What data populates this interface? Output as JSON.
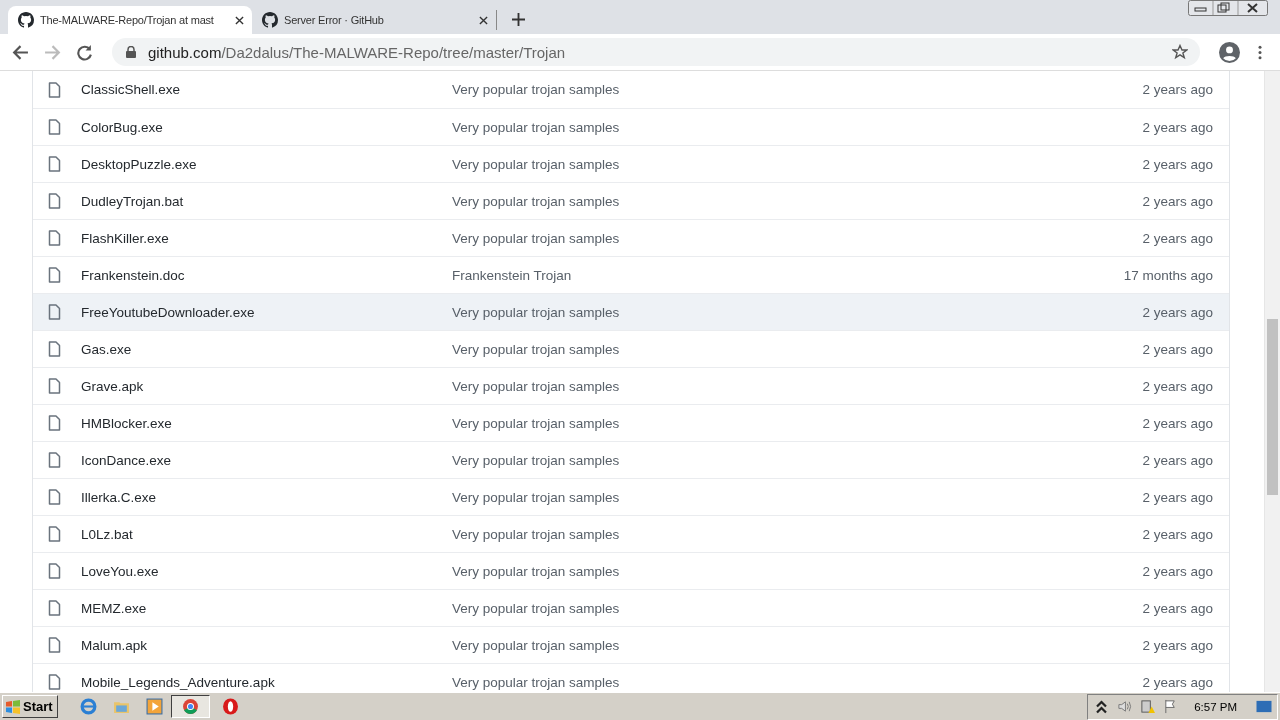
{
  "tabs": [
    {
      "title": "The-MALWARE-Repo/Trojan at mast",
      "selected": true
    },
    {
      "title": "Server Error · GitHub",
      "selected": false
    }
  ],
  "address": {
    "host": "github.com",
    "path": "/Da2dalus/The-MALWARE-Repo/tree/master/Trojan"
  },
  "files": [
    {
      "name": "ClassicShell.exe",
      "message": "Very popular trojan samples",
      "age": "2 years ago",
      "highlighted": false
    },
    {
      "name": "ColorBug.exe",
      "message": "Very popular trojan samples",
      "age": "2 years ago",
      "highlighted": false
    },
    {
      "name": "DesktopPuzzle.exe",
      "message": "Very popular trojan samples",
      "age": "2 years ago",
      "highlighted": false
    },
    {
      "name": "DudleyTrojan.bat",
      "message": "Very popular trojan samples",
      "age": "2 years ago",
      "highlighted": false
    },
    {
      "name": "FlashKiller.exe",
      "message": "Very popular trojan samples",
      "age": "2 years ago",
      "highlighted": false
    },
    {
      "name": "Frankenstein.doc",
      "message": "Frankenstein Trojan",
      "age": "17 months ago",
      "highlighted": false
    },
    {
      "name": "FreeYoutubeDownloader.exe",
      "message": "Very popular trojan samples",
      "age": "2 years ago",
      "highlighted": true
    },
    {
      "name": "Gas.exe",
      "message": "Very popular trojan samples",
      "age": "2 years ago",
      "highlighted": false
    },
    {
      "name": "Grave.apk",
      "message": "Very popular trojan samples",
      "age": "2 years ago",
      "highlighted": false
    },
    {
      "name": "HMBlocker.exe",
      "message": "Very popular trojan samples",
      "age": "2 years ago",
      "highlighted": false
    },
    {
      "name": "IconDance.exe",
      "message": "Very popular trojan samples",
      "age": "2 years ago",
      "highlighted": false
    },
    {
      "name": "Illerka.C.exe",
      "message": "Very popular trojan samples",
      "age": "2 years ago",
      "highlighted": false
    },
    {
      "name": "L0Lz.bat",
      "message": "Very popular trojan samples",
      "age": "2 years ago",
      "highlighted": false
    },
    {
      "name": "LoveYou.exe",
      "message": "Very popular trojan samples",
      "age": "2 years ago",
      "highlighted": false
    },
    {
      "name": "MEMZ.exe",
      "message": "Very popular trojan samples",
      "age": "2 years ago",
      "highlighted": false
    },
    {
      "name": "Malum.apk",
      "message": "Very popular trojan samples",
      "age": "2 years ago",
      "highlighted": false
    },
    {
      "name": "Mobile_Legends_Adventure.apk",
      "message": "Very popular trojan samples",
      "age": "2 years ago",
      "highlighted": false
    }
  ],
  "taskbar": {
    "start": "Start",
    "clock": "6:57 PM"
  }
}
